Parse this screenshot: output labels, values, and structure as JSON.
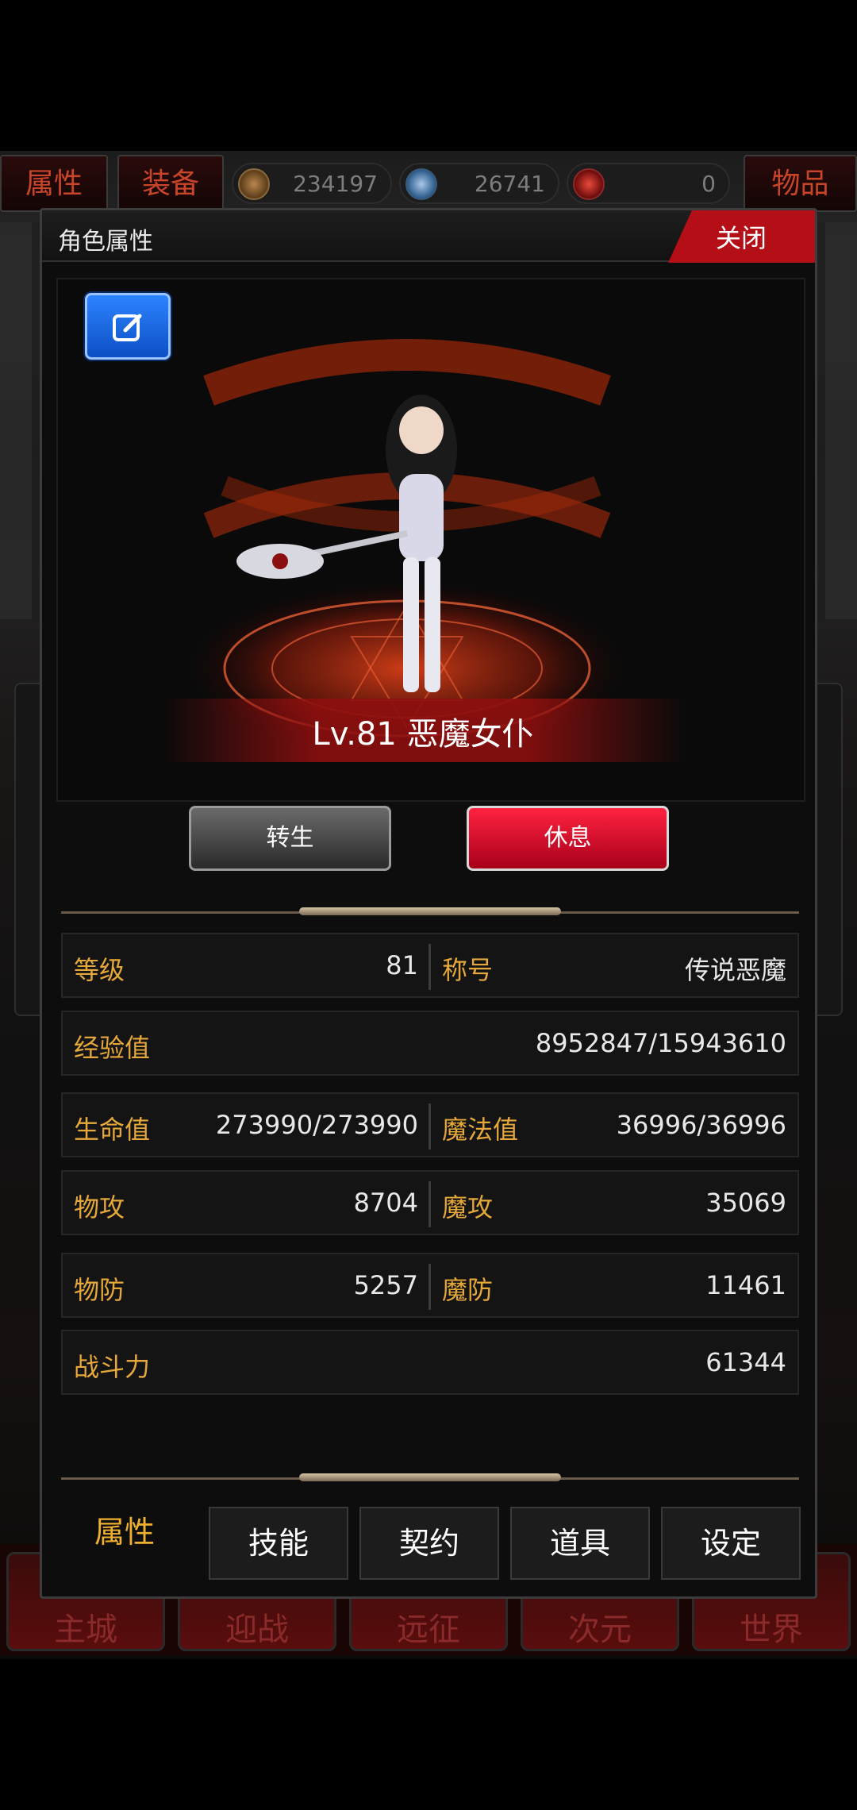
{
  "header": {
    "tabs": {
      "attributes": "属性",
      "equipment": "装备",
      "items": "物品"
    },
    "currencies": [
      {
        "icon": "gold-coin-icon",
        "value": "234197"
      },
      {
        "icon": "blue-gem-icon",
        "value": "26741"
      },
      {
        "icon": "red-gem-icon",
        "value": "0"
      }
    ]
  },
  "dialog": {
    "title": "角色属性",
    "close_label": "关闭",
    "character": {
      "name_line": "Lv.81 恶魔女仆"
    },
    "buttons": {
      "rebirth": "转生",
      "rest": "休息"
    },
    "stats": {
      "level_label": "等级",
      "level_value": "81",
      "title_label": "称号",
      "title_value": "传说恶魔",
      "exp_label": "经验值",
      "exp_value": "8952847/15943610",
      "hp_label": "生命值",
      "hp_value": "273990/273990",
      "mp_label": "魔法值",
      "mp_value": "36996/36996",
      "patk_label": "物攻",
      "patk_value": "8704",
      "matk_label": "魔攻",
      "matk_value": "35069",
      "pdef_label": "物防",
      "pdef_value": "5257",
      "mdef_label": "魔防",
      "mdef_value": "11461",
      "power_label": "战斗力",
      "power_value": "61344"
    },
    "bottom_tabs": [
      "属性",
      "技能",
      "契约",
      "道具",
      "设定"
    ]
  },
  "background": {
    "nav_buttons": [
      "主城",
      "迎战",
      "远征",
      "次元",
      "世界"
    ]
  },
  "colors": {
    "accent_red": "#b40f16",
    "label_gold": "#e6a83a",
    "active_tab_gold": "#f0b030"
  }
}
